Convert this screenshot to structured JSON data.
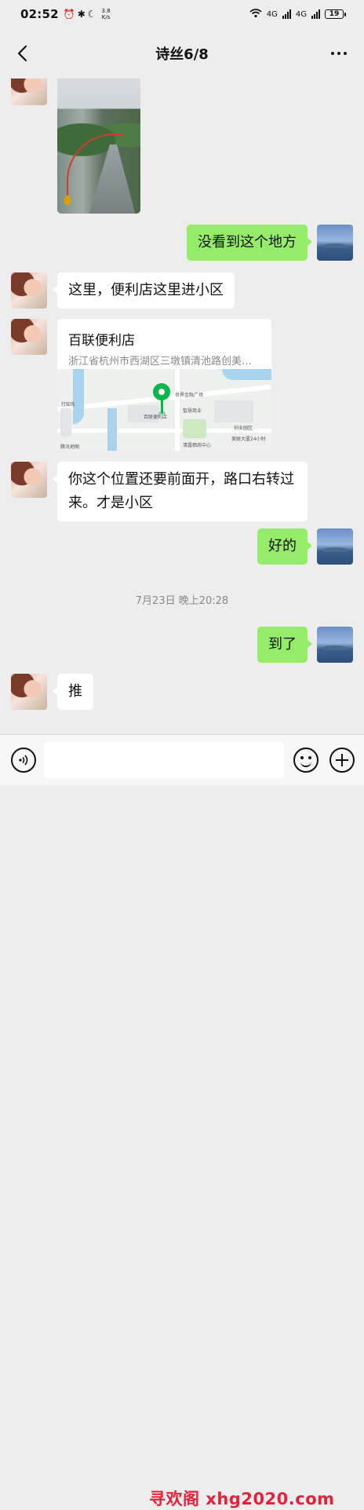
{
  "status_bar": {
    "time": "02:52",
    "network_speed": "3.8",
    "network_speed_unit": "K/s",
    "signal_1": "4G",
    "signal_2": "4G",
    "battery": "19"
  },
  "header": {
    "title": "诗丝6/8",
    "back_icon": "chevron-left-icon",
    "more_icon": "more-dots-icon"
  },
  "messages": [
    {
      "side": "in",
      "type": "image"
    },
    {
      "side": "out",
      "type": "text",
      "text": "没看到这个地方"
    },
    {
      "side": "in",
      "type": "text",
      "text": "这里，便利店这里进小区"
    },
    {
      "side": "in",
      "type": "location",
      "name": "百联便利店",
      "address": "浙江省杭州市西湖区三墩镇清池路创美…"
    },
    {
      "side": "in",
      "type": "text",
      "text": "你这个位置还要前面开，路口右转过来。才是小区"
    },
    {
      "side": "out",
      "type": "text",
      "text": "好的"
    },
    {
      "side": "system",
      "type": "timestamp",
      "text": "7月23日 晚上20:28"
    },
    {
      "side": "out",
      "type": "text",
      "text": "到了"
    },
    {
      "side": "in",
      "type": "text",
      "text": "推"
    }
  ],
  "map_labels": {
    "l1": "行知东",
    "l2": "世界金融广场",
    "l3": "百联便利店",
    "l4": "智慧商业",
    "l5": "腾讯地图",
    "l6": "清露栖商中心",
    "l7": "美联大厦24小时",
    "l8": "创业园区"
  },
  "input_bar": {
    "voice_icon": "voice-icon",
    "emoji_icon": "emoji-icon",
    "plus_icon": "plus-icon"
  },
  "watermark": "寻欢阁 xhg2020.com",
  "colors": {
    "background": "#ededed",
    "outgoing_bubble": "#95ec69",
    "incoming_bubble": "#ffffff",
    "watermark": "#e8213a",
    "map_pin": "#08b64a"
  }
}
